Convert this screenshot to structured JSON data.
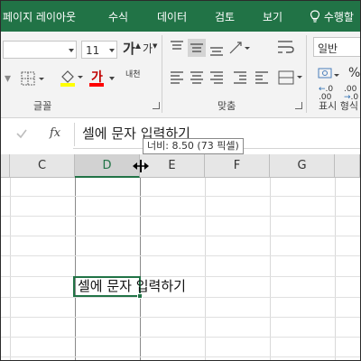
{
  "ribbon_tabs": [
    "페이지 레이아웃",
    "수식",
    "데이터",
    "검토",
    "보기"
  ],
  "tell_me": "수행할",
  "font": {
    "size": "11",
    "grow_label": "가",
    "shrink_label": "가",
    "color_label": "가",
    "phonetic_label": "내천",
    "group_label": "글꼴"
  },
  "alignment": {
    "group_label": "맞춤"
  },
  "number": {
    "format": "일반",
    "percent_label": "%",
    "inc_decimal": ".00",
    "dec_decimal": ".0",
    "group_label": "표시 형식"
  },
  "formula_bar": {
    "fx_label": "fx",
    "content": "셀에 문자 입력하기"
  },
  "columns": [
    "C",
    "D",
    "E",
    "F",
    "G"
  ],
  "selected_column": "D",
  "tooltip": "너비: 8.50 (73 픽셀)",
  "cell": {
    "text": "셀에 문자 입력하기"
  },
  "colors": {
    "accent": "#217346",
    "fill_color": "#ffff00",
    "font_color": "#ff0000"
  }
}
